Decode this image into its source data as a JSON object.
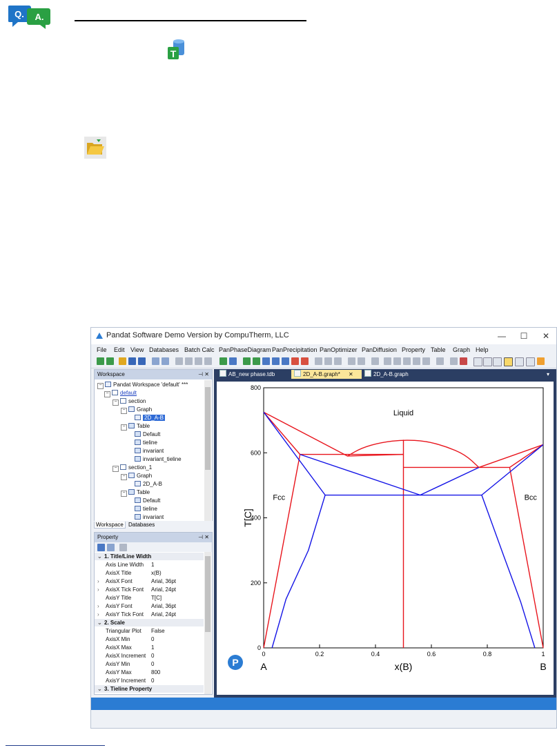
{
  "window": {
    "title": "Pandat Software Demo Version by CompuTherm, LLC",
    "controls": {
      "minimize": "—",
      "maximize": "☐",
      "close": "✕"
    }
  },
  "menu": [
    "File",
    "Edit",
    "View",
    "Databases",
    "Batch Calc",
    "PanPhaseDiagram",
    "PanPrecipitation",
    "PanOptimizer",
    "PanDiffusion",
    "Property",
    "Table",
    "Graph",
    "Help"
  ],
  "workspace": {
    "title": "Workspace",
    "root": "Pandat Workspace 'default' ***",
    "items": {
      "default": "default",
      "section": "section",
      "graph": "Graph",
      "graph_file": "2D_A-B",
      "table": "Table",
      "t_default": "Default",
      "t_tieline": "tieline",
      "t_invariant": "invariant",
      "t_invariant_tieline": "invariant_tieline",
      "section_1": "section_1",
      "graph_1": "Graph",
      "graph_file_1": "2D_A-B",
      "table_1": "Table",
      "t1_default": "Default",
      "t1_tieline": "tieline",
      "t1_invariant": "invariant"
    },
    "tabs": [
      "Workspace",
      "Databases"
    ]
  },
  "property": {
    "title": "Property",
    "rows": [
      {
        "k": "1. Title/Line Width",
        "v": "",
        "cat": true
      },
      {
        "k": "Axis Line Width",
        "v": "1"
      },
      {
        "k": "AxisX Title",
        "v": "x(B)"
      },
      {
        "k": "AxisX Font",
        "v": "Arial, 36pt",
        "arrow": true
      },
      {
        "k": "AxisX Tick Font",
        "v": "Arial, 24pt",
        "arrow": true
      },
      {
        "k": "AxisY Title",
        "v": "T[C]"
      },
      {
        "k": "AxisY Font",
        "v": "Arial, 36pt",
        "arrow": true
      },
      {
        "k": "AxisY Tick Font",
        "v": "Arial, 24pt",
        "arrow": true
      },
      {
        "k": "2. Scale",
        "v": "",
        "cat": true
      },
      {
        "k": "Triangular Plot",
        "v": "False"
      },
      {
        "k": "AxisX Min",
        "v": "0"
      },
      {
        "k": "AxisX Max",
        "v": "1"
      },
      {
        "k": "AxisX Increment",
        "v": "0"
      },
      {
        "k": "AxisY Min",
        "v": "0"
      },
      {
        "k": "AxisY Max",
        "v": "800"
      },
      {
        "k": "AxisY Increment",
        "v": "0"
      },
      {
        "k": "3. Tieline Property",
        "v": "",
        "cat": true
      }
    ]
  },
  "doc_tabs": [
    {
      "label": "AB_new phase.tdb",
      "active": false
    },
    {
      "label": "2D_A-B.graph*",
      "active": true,
      "close": "✕"
    },
    {
      "label": "2D_A-B.graph",
      "active": false
    }
  ],
  "chart_data": {
    "type": "line",
    "xlabel": "x(B)",
    "ylabel": "T[C]",
    "xlim": [
      0,
      1
    ],
    "ylim": [
      0,
      800
    ],
    "x_ticks": [
      "0",
      "0.2",
      "0.4",
      "0.6",
      "0.8",
      "1"
    ],
    "y_ticks": [
      "0",
      "200",
      "400",
      "600",
      "800"
    ],
    "end_labels": {
      "left": "A",
      "right": "B"
    },
    "region_labels": {
      "liquid": "Liquid",
      "fcc": "Fcc",
      "bcc": "Bcc"
    },
    "colors": {
      "red": "#e8141c",
      "blue": "#1414e6"
    },
    "series": [
      {
        "color": "red",
        "points": [
          [
            0,
            725
          ],
          [
            0.3,
            590
          ],
          [
            0.5,
            595
          ]
        ]
      },
      {
        "color": "red",
        "points": [
          [
            0,
            725
          ],
          [
            0.13,
            595
          ]
        ]
      },
      {
        "color": "red",
        "points": [
          [
            0.13,
            595
          ],
          [
            0.5,
            595
          ]
        ]
      },
      {
        "color": "red",
        "points": [
          [
            0,
            0
          ],
          [
            0.13,
            595
          ]
        ]
      },
      {
        "color": "red",
        "points": [
          [
            0.5,
            0
          ],
          [
            0.5,
            640
          ]
        ]
      },
      {
        "color": "red",
        "points": [
          [
            0.5,
            555
          ],
          [
            0.88,
            555
          ]
        ]
      },
      {
        "color": "red",
        "points": [
          [
            0.77,
            555
          ],
          [
            1,
            625
          ]
        ]
      },
      {
        "color": "red",
        "points": [
          [
            0.88,
            555
          ],
          [
            1,
            625
          ]
        ]
      },
      {
        "color": "red",
        "points": [
          [
            0.88,
            555
          ],
          [
            1,
            0
          ]
        ]
      },
      {
        "color": "red",
        "curve": [
          [
            0.3,
            590
          ],
          [
            0.35,
            615
          ],
          [
            0.42,
            632
          ],
          [
            0.5,
            640
          ],
          [
            0.58,
            636
          ],
          [
            0.65,
            620
          ],
          [
            0.72,
            595
          ],
          [
            0.77,
            555
          ]
        ]
      },
      {
        "color": "blue",
        "points": [
          [
            0,
            725
          ],
          [
            0.22,
            470
          ],
          [
            0.78,
            470
          ],
          [
            1,
            625
          ]
        ]
      },
      {
        "color": "blue",
        "points": [
          [
            0.13,
            595
          ],
          [
            0.56,
            470
          ],
          [
            0.77,
            555
          ]
        ]
      },
      {
        "color": "blue",
        "points": [
          [
            0.22,
            470
          ],
          [
            0.16,
            300
          ],
          [
            0.08,
            150
          ],
          [
            0.03,
            0
          ]
        ]
      },
      {
        "color": "blue",
        "points": [
          [
            0.78,
            470
          ],
          [
            0.86,
            280
          ],
          [
            0.92,
            140
          ],
          [
            0.97,
            0
          ]
        ]
      }
    ]
  }
}
